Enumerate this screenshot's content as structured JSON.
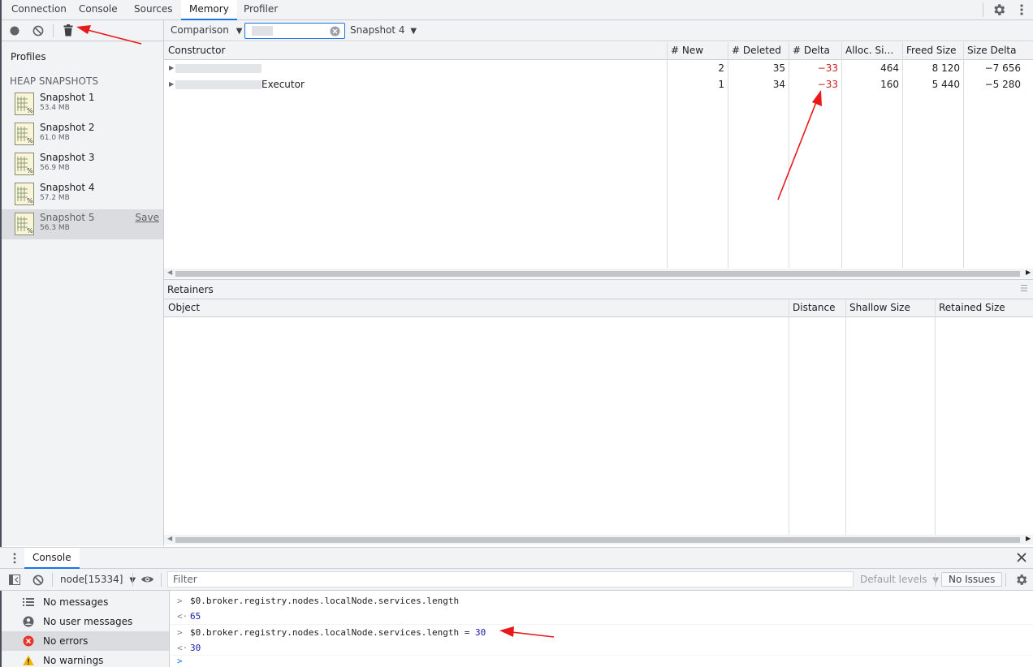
{
  "top_tabs": [
    "Connection",
    "Console",
    "Sources",
    "Memory",
    "Profiler"
  ],
  "active_tab": "Memory",
  "sidebar": {
    "profiles_label": "Profiles",
    "section_label": "HEAP SNAPSHOTS",
    "snapshots": [
      {
        "name": "Snapshot 1",
        "size": "53.4 MB"
      },
      {
        "name": "Snapshot 2",
        "size": "61.0 MB"
      },
      {
        "name": "Snapshot 3",
        "size": "56.9 MB"
      },
      {
        "name": "Snapshot 4",
        "size": "57.2 MB"
      },
      {
        "name": "Snapshot 5",
        "size": "56.3 MB",
        "save_label": "Save"
      }
    ]
  },
  "toolbar": {
    "view_select": "Comparison",
    "filter_value": "",
    "base_snapshot_select": "Snapshot 4"
  },
  "comparison_table": {
    "columns": [
      "Constructor",
      "# New",
      "# Deleted",
      "# Delta",
      "Alloc. Si…",
      "Freed Size",
      "Size Delta"
    ],
    "rows": [
      {
        "constructor": "",
        "new": "2",
        "deleted": "35",
        "delta": "−33",
        "alloc": "464",
        "freed": "8 120",
        "size_delta": "−7 656"
      },
      {
        "constructor": "Executor",
        "new": "1",
        "deleted": "34",
        "delta": "−33",
        "alloc": "160",
        "freed": "5 440",
        "size_delta": "−5 280"
      }
    ]
  },
  "retainers": {
    "title": "Retainers",
    "columns": [
      "Object",
      "Distance",
      "Shallow Size",
      "Retained Size"
    ]
  },
  "drawer": {
    "tab_label": "Console",
    "context_select": "node[15334]",
    "filter_placeholder": "Filter",
    "levels_select": "Default levels",
    "issues_button": "No Issues"
  },
  "console_sidebar": [
    {
      "label": "No messages",
      "icon": "list-icon"
    },
    {
      "label": "No user messages",
      "icon": "user-icon"
    },
    {
      "label": "No errors",
      "icon": "error-icon",
      "selected": true
    },
    {
      "label": "No warnings",
      "icon": "warning-icon"
    }
  ],
  "console_lines": [
    {
      "type": "input",
      "text": "$0.broker.registry.nodes.localNode.services.length"
    },
    {
      "type": "result",
      "text": "65"
    },
    {
      "type": "input",
      "text": "$0.broker.registry.nodes.localNode.services.length = ",
      "value": "30"
    },
    {
      "type": "result",
      "text": "30"
    }
  ],
  "colors": {
    "accent": "#1a73e8",
    "annotation_red": "#e8191a",
    "delta_orange": "#c5221f",
    "console_value_blue": "#1a1aa6"
  }
}
